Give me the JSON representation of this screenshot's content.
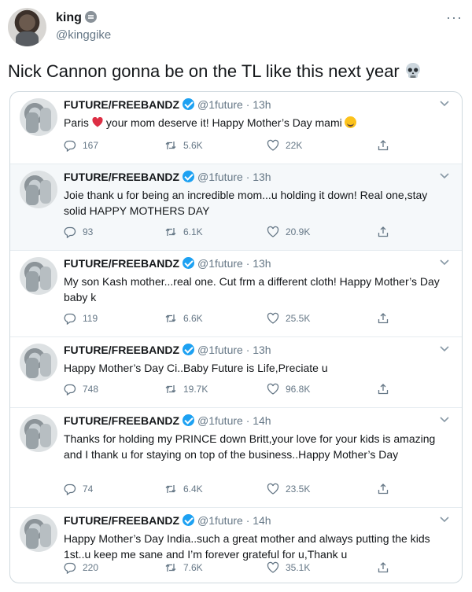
{
  "outer": {
    "name": "king",
    "handle": "@kinggike",
    "more": "···",
    "text": "Nick Cannon gonna be on the TL like this next year",
    "emoji_icon": "skull-icon"
  },
  "colors": {
    "verified": "#1da1f2",
    "muted": "#657786",
    "border": "#cfd9de",
    "highlight_bg": "#f5f8fa"
  },
  "tweets": [
    {
      "name": "FUTURE/FREEBANDZ",
      "handle": "@1future · 13h",
      "text_before": "Paris",
      "text_after": "your mom deserve it! Happy Mother’s Day mami",
      "replies": "167",
      "retweets": "5.6K",
      "likes": "22K"
    },
    {
      "name": "FUTURE/FREEBANDZ",
      "handle": "@1future · 13h",
      "text": "Joie thank u for being an incredible mom...u holding it down! Real one,stay solid HAPPY MOTHERS DAY",
      "replies": "93",
      "retweets": "6.1K",
      "likes": "20.9K"
    },
    {
      "name": "FUTURE/FREEBANDZ",
      "handle": "@1future · 13h",
      "text": "My son Kash mother...real one. Cut frm a different cloth! Happy Mother’s Day baby k",
      "replies": "119",
      "retweets": "6.6K",
      "likes": "25.5K"
    },
    {
      "name": "FUTURE/FREEBANDZ",
      "handle": "@1future · 13h",
      "text": "Happy Mother’s Day Ci..Baby Future is Life,Preciate u",
      "replies": "748",
      "retweets": "19.7K",
      "likes": "96.8K"
    },
    {
      "name": "FUTURE/FREEBANDZ",
      "handle": "@1future · 14h",
      "text": "Thanks for holding my PRINCE down Britt,your love for your kids is amazing and I thank u for staying on top of the business..Happy Mother’s Day",
      "replies": "74",
      "retweets": "6.4K",
      "likes": "23.5K"
    },
    {
      "name": "FUTURE/FREEBANDZ",
      "handle": "@1future · 14h",
      "text": "Happy Mother’s Day India..such a great mother and always putting the kids 1st..u keep me sane and I’m forever grateful for u,Thank u",
      "replies": "220",
      "retweets": "7.6K",
      "likes": "35.1K"
    }
  ]
}
